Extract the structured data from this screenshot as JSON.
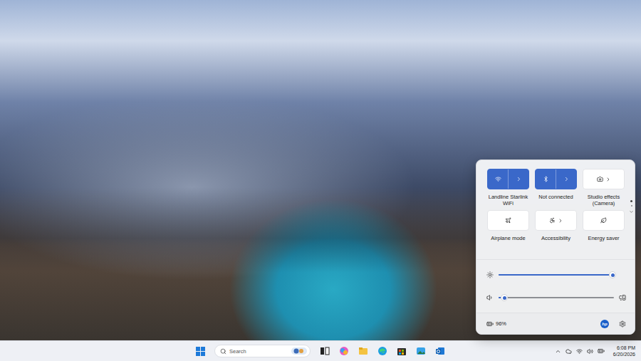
{
  "quick_settings": {
    "tiles": [
      {
        "label": "Landline Starlink WiFi",
        "on": true,
        "expandable": true
      },
      {
        "label": "Not connected",
        "on": true,
        "expandable": true
      },
      {
        "label": "Studio effects (Camera)",
        "on": false,
        "expandable": true
      },
      {
        "label": "Airplane mode",
        "on": false,
        "expandable": false
      },
      {
        "label": "Accessibility",
        "on": false,
        "expandable": true
      },
      {
        "label": "Energy saver",
        "on": false,
        "expandable": false
      }
    ],
    "pages": [
      {
        "selected": true
      },
      {
        "selected": false
      }
    ],
    "sliders": [
      {
        "level": 0.99
      },
      {
        "level": 0.05
      }
    ],
    "battery": "96%",
    "brand": "hp"
  },
  "taskbar": {
    "search": {
      "placeholder": "Search"
    },
    "clock": {
      "time": "6:08 PM",
      "date": "6/20/2026"
    }
  }
}
